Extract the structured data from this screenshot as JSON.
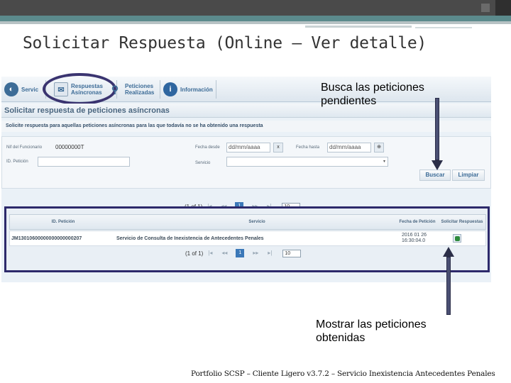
{
  "slide": {
    "title": "Solicitar Respuesta (Online – Ver detalle)",
    "footer": "Portfolio SCSP – Cliente Ligero v3.7.2 – Servicio Inexistencia Antecedentes Penales"
  },
  "nav": {
    "items": [
      {
        "label1": "Servic",
        "label2": "",
        "icon": "globe-icon"
      },
      {
        "label1": "Respuestas",
        "label2": "Asíncronas",
        "icon": "envelope-icon"
      },
      {
        "label1": "Peticiones",
        "label2": "Realizadas",
        "icon": "magnifier-icon"
      },
      {
        "label1": "Información",
        "label2": "",
        "icon": "info-icon"
      }
    ]
  },
  "page": {
    "section_title": "Solicitar respuesta de peticiones asíncronas",
    "subtitle": "Solicite respuesta para aquellas peticiones asíncronas para las que todavía no se ha obtenido una respuesta"
  },
  "form": {
    "funcionario_label": "Nif del Funcionario",
    "funcionario_value": "00000000T",
    "fecha_desde_label": "Fecha desde",
    "fecha_desde_placeholder": "dd/mm/aaaa",
    "fecha_hasta_label": "Fecha hasta",
    "fecha_hasta_placeholder": "dd/mm/aaaa",
    "id_peticion_label": "ID. Petición",
    "servicio_label": "Servicio",
    "clear_btn": "x",
    "calendar_btn": "⊕",
    "buscar": "Buscar",
    "limpiar": "Limpiar"
  },
  "pager": {
    "text": "(1 of 1)",
    "current": "1",
    "rows": "10"
  },
  "table": {
    "headers": {
      "id": "ID. Petición",
      "servicio": "Servicio",
      "fecha": "Fecha de Petición",
      "solicitar": "Solicitar Respuestas"
    },
    "rows": [
      {
        "id": "JM13010600000000000000207",
        "servicio": "Servicio de Consulta de Inexistencia de Antecedentes Penales",
        "fecha1": "2016 01 26",
        "fecha2": "16:30:04.0"
      }
    ]
  },
  "annotations": {
    "top_note": "Busca las peticiones pendientes",
    "top_note_l1": "Busca las peticiones",
    "top_note_l2": "pendientes",
    "bottom_note_l1": "Mostrar las peticiones",
    "bottom_note_l2": "obtenidas"
  }
}
